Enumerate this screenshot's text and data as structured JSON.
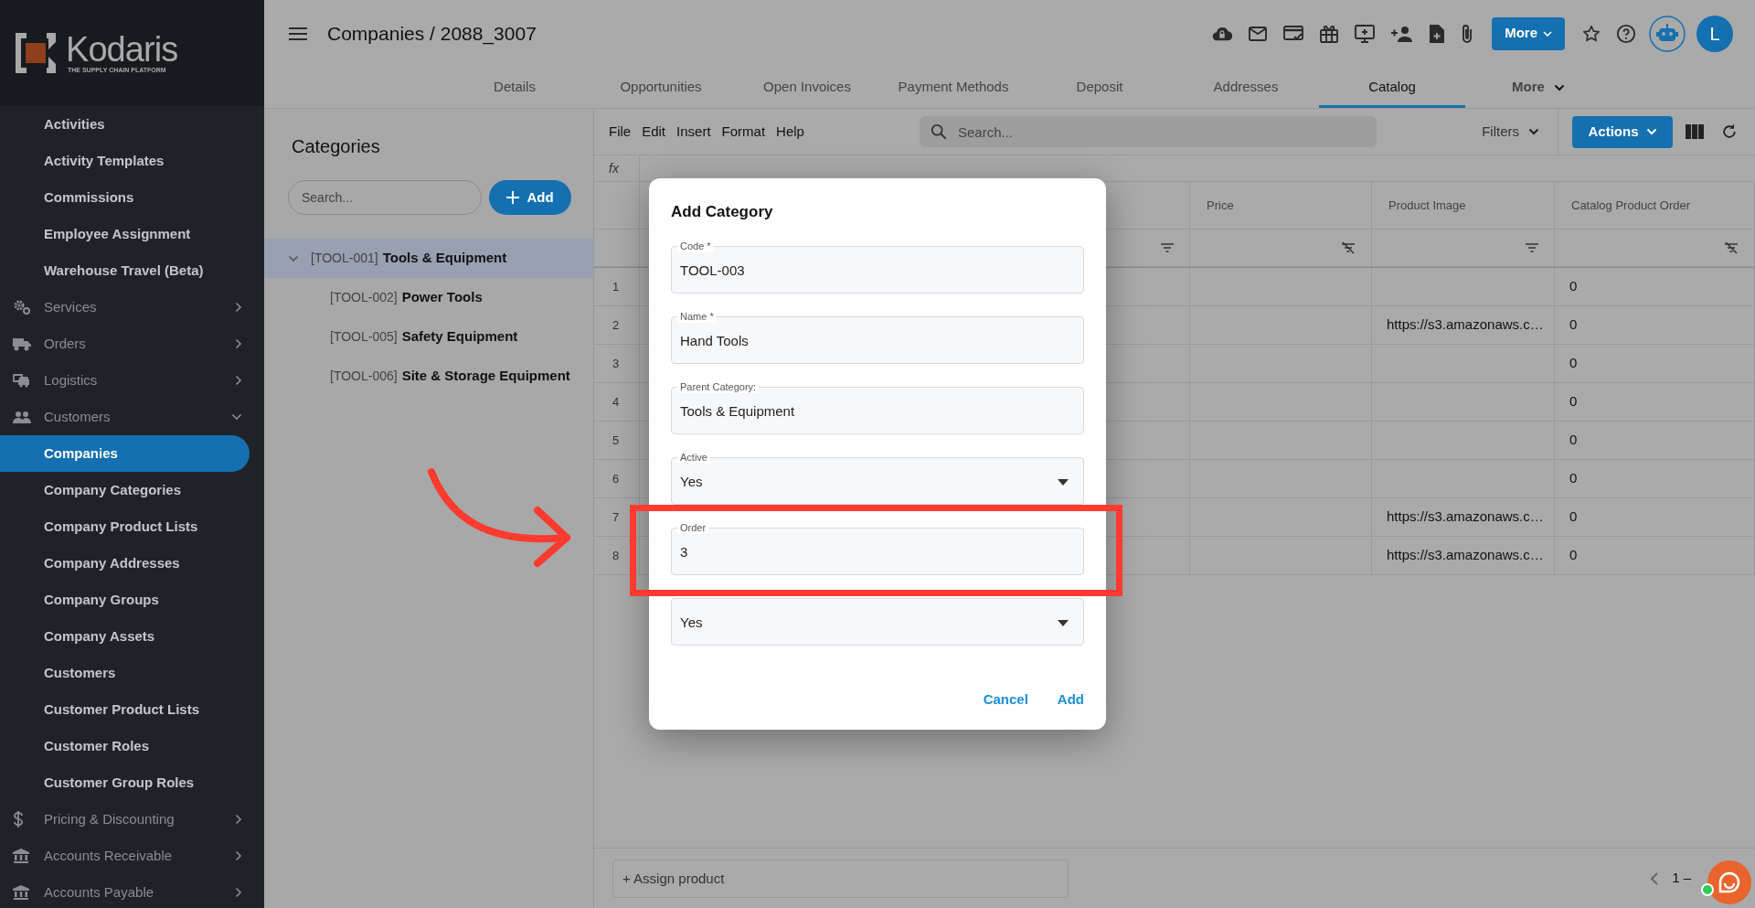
{
  "sidebar": {
    "logo": {
      "name": "Kodaris",
      "tagline": "THE SUPPLY CHAIN PLATFORM"
    },
    "items": [
      {
        "label": "Activities",
        "kind": "link",
        "selected": false
      },
      {
        "label": "Activity Templates",
        "kind": "link",
        "selected": false
      },
      {
        "label": "Commissions",
        "kind": "link",
        "selected": false
      },
      {
        "label": "Employee Assignment",
        "kind": "link",
        "selected": false
      },
      {
        "label": "Warehouse Travel (Beta)",
        "kind": "link",
        "selected": false
      },
      {
        "label": "Services",
        "kind": "group",
        "expanded": false,
        "selected": false
      },
      {
        "label": "Orders",
        "kind": "group",
        "expanded": false,
        "selected": false
      },
      {
        "label": "Logistics",
        "kind": "group",
        "expanded": false,
        "selected": false
      },
      {
        "label": "Customers",
        "kind": "group",
        "expanded": true,
        "selected": false
      },
      {
        "label": "Companies",
        "kind": "link",
        "selected": true
      },
      {
        "label": "Company Categories",
        "kind": "link",
        "selected": false
      },
      {
        "label": "Company Product Lists",
        "kind": "link",
        "selected": false
      },
      {
        "label": "Company Addresses",
        "kind": "link",
        "selected": false
      },
      {
        "label": "Company Groups",
        "kind": "link",
        "selected": false
      },
      {
        "label": "Company Assets",
        "kind": "link",
        "selected": false
      },
      {
        "label": "Customers",
        "kind": "link",
        "selected": false
      },
      {
        "label": "Customer Product Lists",
        "kind": "link",
        "selected": false
      },
      {
        "label": "Customer Roles",
        "kind": "link",
        "selected": false
      },
      {
        "label": "Customer Group Roles",
        "kind": "link",
        "selected": false
      },
      {
        "label": "Pricing & Discounting",
        "kind": "group",
        "expanded": false,
        "selected": false
      },
      {
        "label": "Accounts Receivable",
        "kind": "group",
        "expanded": false,
        "selected": false
      },
      {
        "label": "Accounts Payable",
        "kind": "group",
        "expanded": false,
        "selected": false
      }
    ]
  },
  "header": {
    "title": "Companies / 2088_3007",
    "more_button": "More",
    "avatar": "L"
  },
  "tabs": [
    {
      "label": "Details",
      "kind": "tab",
      "selected": false
    },
    {
      "label": "Opportunities",
      "kind": "tab",
      "selected": false
    },
    {
      "label": "Open Invoices",
      "kind": "tab",
      "selected": false
    },
    {
      "label": "Payment Methods",
      "kind": "tab",
      "selected": false
    },
    {
      "label": "Deposit",
      "kind": "tab",
      "selected": false
    },
    {
      "label": "Addresses",
      "kind": "tab",
      "selected": false
    },
    {
      "label": "Catalog",
      "kind": "tab",
      "selected": true
    },
    {
      "label": "More",
      "kind": "menu",
      "selected": false
    }
  ],
  "categories": {
    "title": "Categories",
    "search": {
      "placeholder": "Search..."
    },
    "add_button": "Add",
    "tree": [
      {
        "code": "[TOOL-001]",
        "name": "Tools & Equipment",
        "expanded": true,
        "selected": true,
        "children": [
          {
            "code": "[TOOL-002]",
            "name": "Power Tools",
            "selected": false
          },
          {
            "code": "[TOOL-005]",
            "name": "Safety Equipment",
            "selected": false
          },
          {
            "code": "[TOOL-006]",
            "name": "Site & Storage Equipment",
            "selected": false
          }
        ]
      }
    ]
  },
  "grid": {
    "menu": [
      "File",
      "Edit",
      "Insert",
      "Format",
      "Help"
    ],
    "search": {
      "placeholder": "Search..."
    },
    "filters": "Filters",
    "actions_button": "Actions",
    "formula_label": "fx",
    "columns": [
      {
        "filter_cleared": false
      },
      {
        "label": "Price",
        "filter_cleared": true
      },
      {
        "label": "Product Image",
        "filter_cleared": false
      },
      {
        "label": "Catalog Product Order",
        "filter_cleared": true
      }
    ],
    "rows": [
      {
        "number": "1",
        "catalog_product_order": "0"
      },
      {
        "number": "2",
        "product_image": "https://s3.amazonaws.c…",
        "catalog_product_order": "0"
      },
      {
        "number": "3",
        "catalog_product_order": "0"
      },
      {
        "number": "4",
        "catalog_product_order": "0"
      },
      {
        "number": "5",
        "catalog_product_order": "0"
      },
      {
        "number": "6",
        "catalog_product_order": "0"
      },
      {
        "number": "7",
        "product_image": "https://s3.amazonaws.c…",
        "catalog_product_order": "0"
      },
      {
        "number": "8",
        "product_image": "https://s3.amazonaws.c…",
        "catalog_product_order": "0"
      }
    ],
    "assign_field": {
      "placeholder": "+ Assign product"
    },
    "pagination": "1 –"
  },
  "dialog": {
    "title": "Add Category",
    "fields": [
      {
        "kind": "text",
        "label": "Code *",
        "value": "TOOL-003"
      },
      {
        "kind": "text",
        "label": "Name *",
        "value": "Hand Tools"
      },
      {
        "kind": "text",
        "label": "Parent Category:",
        "value": "Tools & Equipment"
      },
      {
        "kind": "select",
        "label": "Active",
        "value": "Yes"
      },
      {
        "kind": "text",
        "label": "Order",
        "value": "3"
      },
      {
        "kind": "select",
        "value": "Yes"
      }
    ],
    "buttons": [
      "Cancel",
      "Add"
    ]
  }
}
